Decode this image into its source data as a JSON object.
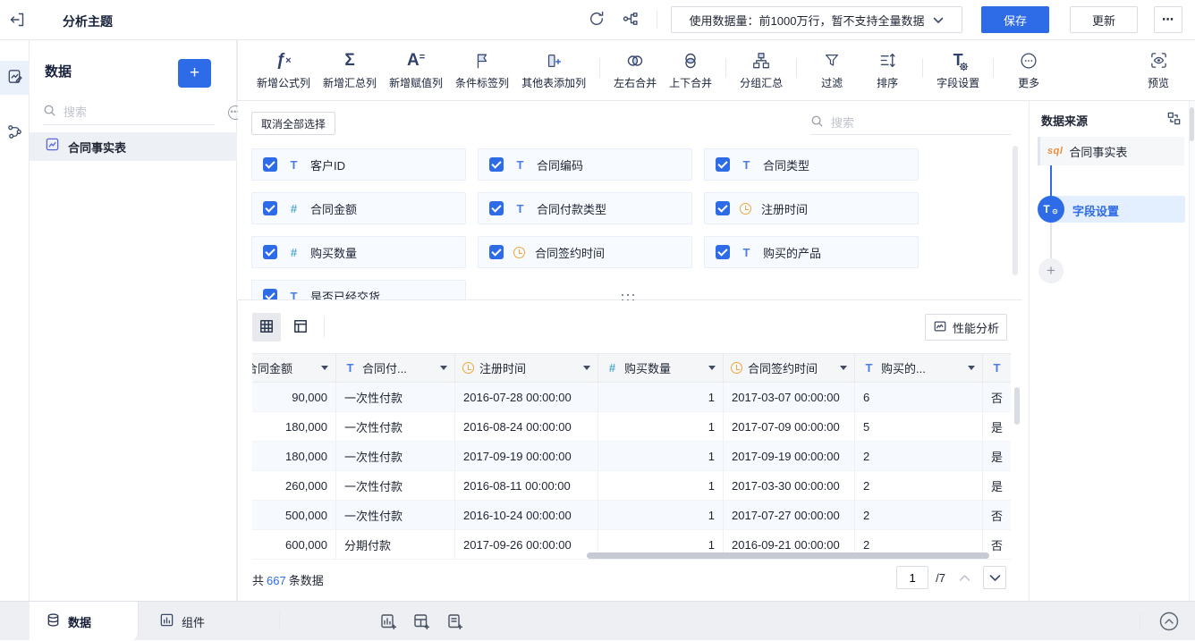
{
  "colors": {
    "accent": "#2e6be6",
    "text_field_icon": "#4c7ce4",
    "number_field_icon": "#55a9c9",
    "date_field_icon": "#f0a63c",
    "sql_badge": "#f08c3a"
  },
  "topbar": {
    "title": "分析主题",
    "data_usage": "使用数据量：前1000万行，暂不支持全量数据",
    "save": "保存",
    "update": "更新",
    "more": "⋯"
  },
  "sidebar": {
    "title": "数据",
    "add": "+",
    "search_placeholder": "搜索",
    "items": [
      {
        "label": "合同事实表"
      }
    ]
  },
  "toolbar": {
    "items": [
      {
        "label": "新增公式列"
      },
      {
        "label": "新增汇总列"
      },
      {
        "label": "新增赋值列"
      },
      {
        "label": "条件标签列"
      },
      {
        "label": "其他表添加列"
      },
      {
        "label": "左右合并"
      },
      {
        "label": "上下合并"
      },
      {
        "label": "分组汇总"
      },
      {
        "label": "过滤"
      },
      {
        "label": "排序"
      },
      {
        "label": "字段设置"
      },
      {
        "label": "更多"
      },
      {
        "label": "预览"
      }
    ]
  },
  "field_panel": {
    "deselect_all": "取消全部选择",
    "search_placeholder": "搜索",
    "fields": [
      {
        "name": "客户ID",
        "type": "text",
        "checked": true
      },
      {
        "name": "合同编码",
        "type": "text",
        "checked": true
      },
      {
        "name": "合同类型",
        "type": "text",
        "checked": true
      },
      {
        "name": "合同金额",
        "type": "number",
        "checked": true
      },
      {
        "name": "合同付款类型",
        "type": "text",
        "checked": true
      },
      {
        "name": "注册时间",
        "type": "date",
        "checked": true
      },
      {
        "name": "购买数量",
        "type": "number",
        "checked": true
      },
      {
        "name": "合同签约时间",
        "type": "date",
        "checked": true
      },
      {
        "name": "购买的产品",
        "type": "text",
        "checked": true
      },
      {
        "name": "是否已经交货",
        "type": "text",
        "checked": true
      }
    ]
  },
  "datasource": {
    "title": "数据来源",
    "table_node": {
      "badge": "sql",
      "label": "合同事实表"
    },
    "step_node": {
      "icon_letter": "T",
      "label": "字段设置"
    },
    "add": "+"
  },
  "table": {
    "performance_button": "性能分析",
    "columns": [
      {
        "label": "合同金额",
        "type": "none"
      },
      {
        "label": "合同付...",
        "type": "text"
      },
      {
        "label": "注册时间",
        "type": "date"
      },
      {
        "label": "购买数量",
        "type": "number"
      },
      {
        "label": "合同签约时间",
        "type": "date"
      },
      {
        "label": "购买的...",
        "type": "text"
      },
      {
        "label": "",
        "type": "text"
      }
    ],
    "rows": [
      [
        "90,000",
        "一次性付款",
        "2016-07-28 00:00:00",
        "1",
        "2017-03-07 00:00:00",
        "6",
        "否"
      ],
      [
        "180,000",
        "一次性付款",
        "2016-08-24 00:00:00",
        "1",
        "2017-07-09 00:00:00",
        "5",
        "是"
      ],
      [
        "180,000",
        "一次性付款",
        "2017-09-19 00:00:00",
        "1",
        "2017-09-19 00:00:00",
        "2",
        "是"
      ],
      [
        "260,000",
        "一次性付款",
        "2016-08-11 00:00:00",
        "1",
        "2017-03-30 00:00:00",
        "2",
        "是"
      ],
      [
        "500,000",
        "一次性付款",
        "2016-10-24 00:00:00",
        "1",
        "2017-07-27 00:00:00",
        "2",
        "否"
      ],
      [
        "600,000",
        "分期付款",
        "2017-09-26 00:00:00",
        "1",
        "2016-09-21 00:00:00",
        "2",
        "否"
      ]
    ],
    "footer": {
      "total_prefix": "共",
      "total_count": "667",
      "total_suffix": "条数据",
      "page": "1",
      "page_total": "/7"
    }
  },
  "bottombar": {
    "tabs": [
      {
        "label": "数据"
      },
      {
        "label": "组件"
      }
    ]
  }
}
